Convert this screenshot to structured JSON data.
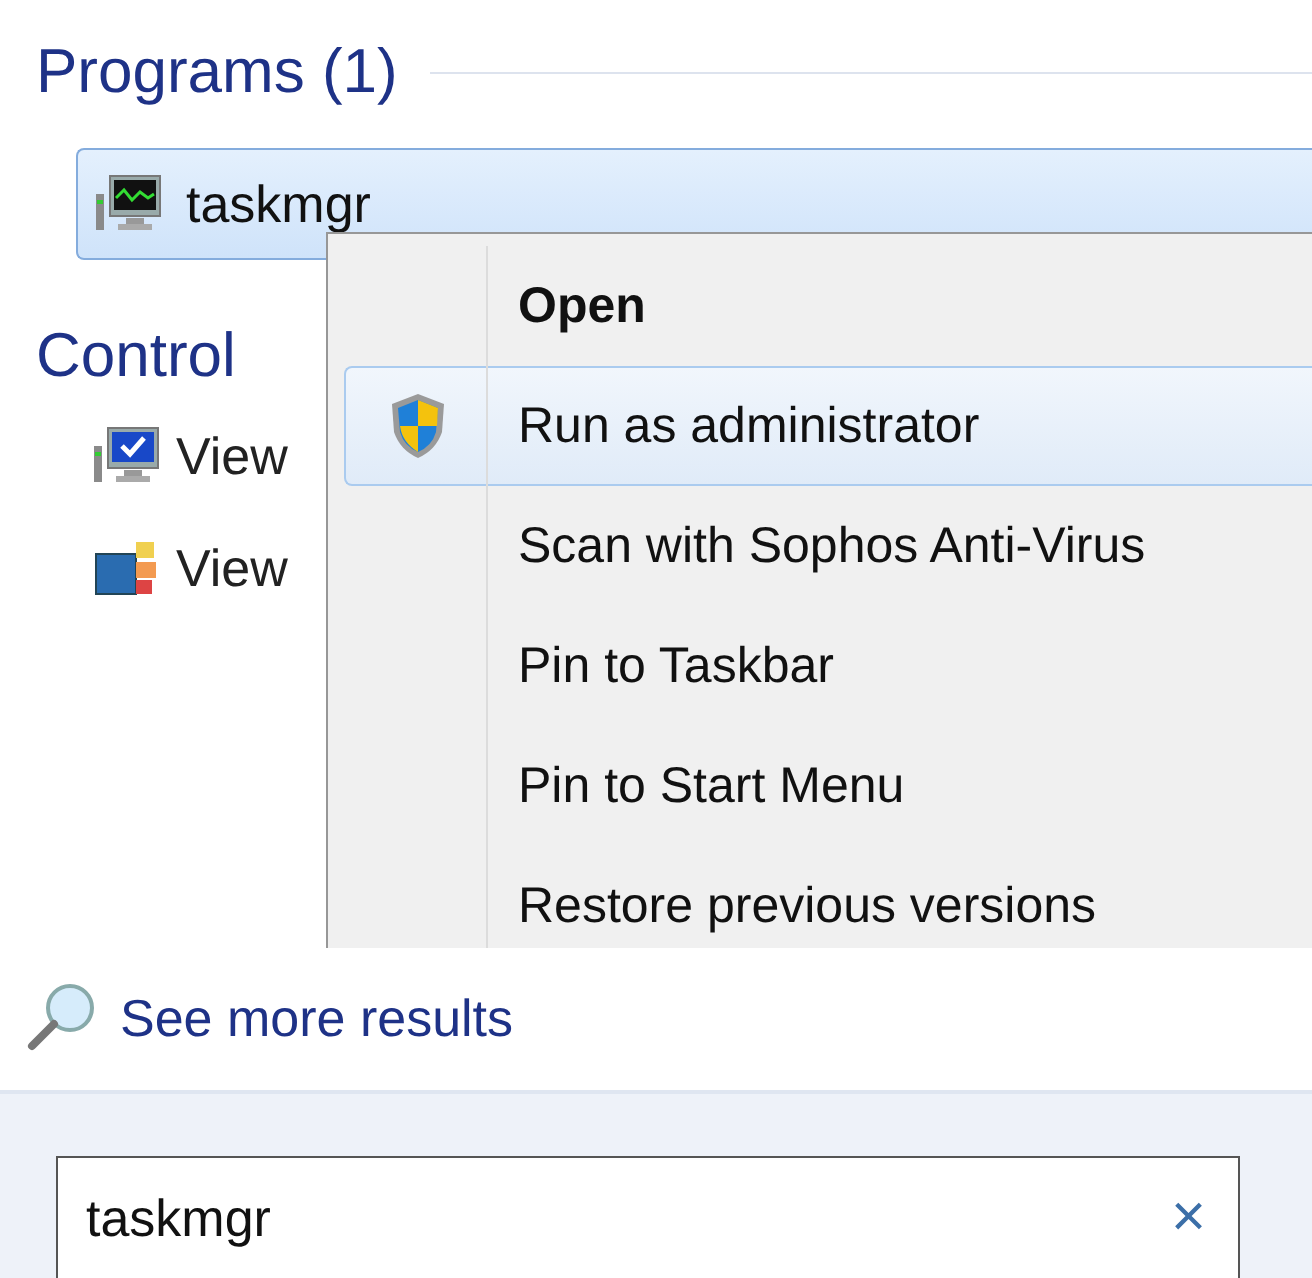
{
  "programs": {
    "header": "Programs (1)",
    "items": [
      {
        "label": "taskmgr",
        "selected": true
      }
    ]
  },
  "control_panel": {
    "header": "Control",
    "items": [
      {
        "label": "View",
        "kind": "system"
      },
      {
        "label": "View",
        "kind": "windows"
      }
    ]
  },
  "context_menu": {
    "items": [
      {
        "label": "Open",
        "kind": "default",
        "selected": false
      },
      {
        "label": "Run as administrator",
        "kind": "admin",
        "selected": true
      },
      {
        "label": "Scan with Sophos Anti-Virus",
        "kind": "plain",
        "selected": false
      },
      {
        "label": "Pin to Taskbar",
        "kind": "plain",
        "selected": false
      },
      {
        "label": "Pin to Start Menu",
        "kind": "plain",
        "selected": false
      },
      {
        "label": "Restore previous versions",
        "kind": "plain",
        "selected": false
      }
    ]
  },
  "see_more": "See more results",
  "search": {
    "value": "taskmgr",
    "clear": "×"
  }
}
